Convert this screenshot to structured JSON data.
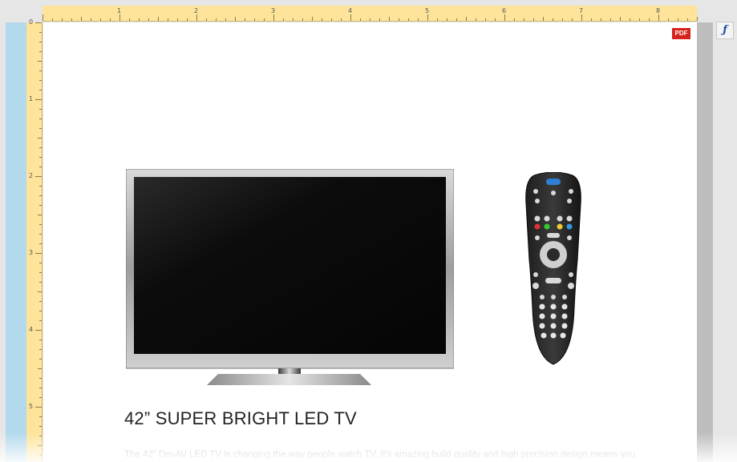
{
  "ruler": {
    "top_numbers": [
      "1",
      "2",
      "3",
      "4",
      "5",
      "6",
      "7",
      "8"
    ],
    "left_numbers": [
      "0",
      "1",
      "2",
      "3",
      "4",
      "5"
    ]
  },
  "toolbar": {
    "pdf_label": "PDF",
    "function_label": "ƒ"
  },
  "product": {
    "title": "42” SUPER BRIGHT LED TV",
    "description": "The 42” DevAV LED TV is changing the way people watch TV. It's amazing build quality and high precision design means you"
  },
  "colors": {
    "ruler": "#fde49a",
    "left_strip": "#b2d9ec",
    "pdf_badge": "#d5231b",
    "function_icon": "#1a4fa0"
  },
  "icons": {
    "pdf": "pdf-icon",
    "function": "function-icon"
  }
}
